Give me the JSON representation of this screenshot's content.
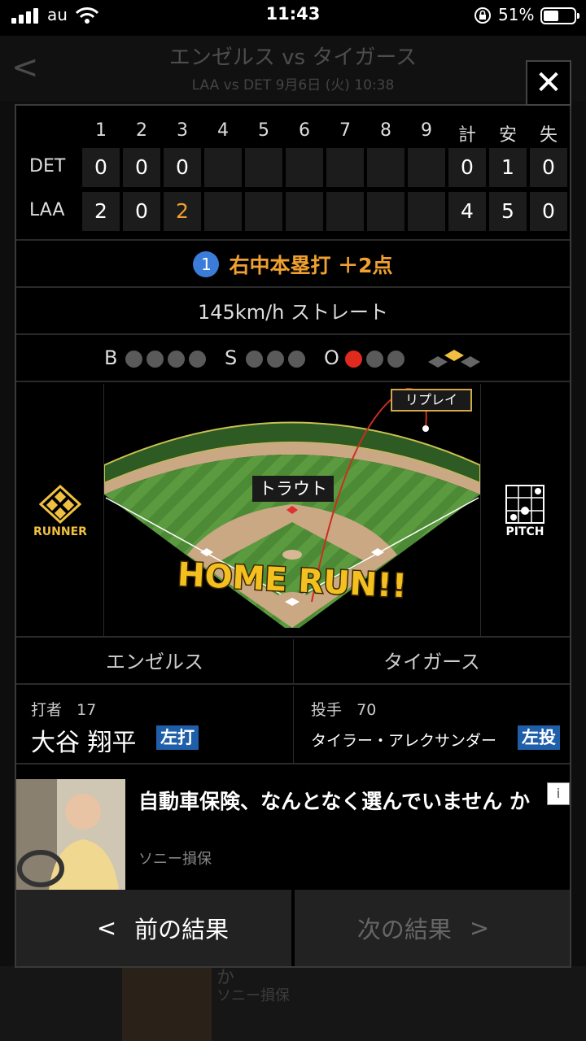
{
  "status_bar": {
    "carrier": "au",
    "time": "11:43",
    "battery": "51%",
    "battery_level": 0.51
  },
  "background_page": {
    "title": "エンゼルス vs タイガース",
    "subtitle": "LAA vs DET 9月6日 (火) 10:38",
    "back_label": "<"
  },
  "modal": {
    "close_label": "✕",
    "scoreboard": {
      "headers": [
        "1",
        "2",
        "3",
        "4",
        "5",
        "6",
        "7",
        "8",
        "9",
        "計",
        "安",
        "失"
      ],
      "rows": [
        {
          "team": "DET",
          "innings": [
            "0",
            "0",
            "0",
            "",
            "",
            "",
            "",
            "",
            ""
          ],
          "totals": [
            "0",
            "1",
            "0"
          ]
        },
        {
          "team": "LAA",
          "innings": [
            "2",
            "0",
            "2",
            "",
            "",
            "",
            "",
            "",
            ""
          ],
          "totals": [
            "4",
            "5",
            "0"
          ]
        }
      ]
    },
    "play_result": {
      "number": "1",
      "text": "右中本塁打 ＋2点"
    },
    "pitch": "145km/h ストレート",
    "count": {
      "b_label": "B",
      "s_label": "S",
      "o_label": "O",
      "balls": 0,
      "balls_max": 4,
      "strikes": 0,
      "strikes_max": 3,
      "outs": 1,
      "outs_max": 3
    },
    "field": {
      "runner_label": "RUNNER",
      "pitch_label": "PITCH",
      "batter_tag": "トラウト",
      "replay_label": "リプレイ",
      "home_run_text": "HOME RUN!!"
    },
    "teams": {
      "home": "エンゼルス",
      "away": "タイガース"
    },
    "batter": {
      "role": "打者",
      "number": "17",
      "name": "大谷 翔平",
      "hand": "左打"
    },
    "pitcher": {
      "role": "投手",
      "number": "70",
      "name": "タイラー・アレクサンダー",
      "hand": "左投"
    },
    "ad": {
      "title": "自動車保険、なんとなく選んでいません か",
      "sponsor": "ソニー損保",
      "info_label": "i"
    },
    "nav": {
      "prev": "前の結果",
      "next": "次の結果",
      "prev_arrow": "<",
      "next_arrow": ">"
    }
  },
  "bg_bottom": {
    "line1": "か",
    "line2": "ソニー損保"
  }
}
